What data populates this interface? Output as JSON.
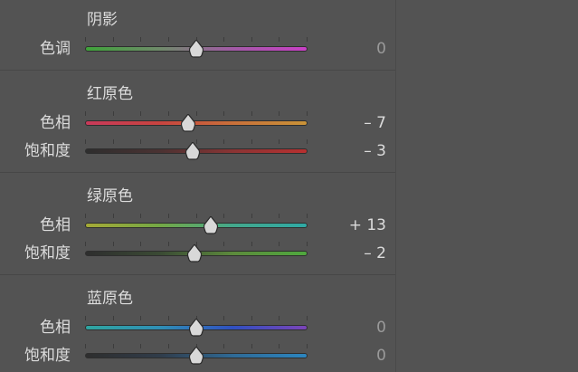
{
  "sections": [
    {
      "title": "阴影",
      "rows": [
        {
          "label": "色调",
          "value": "0",
          "level": 0.5,
          "gradient": [
            "#3fa33a",
            "#6f8a6a",
            "#a25aa6",
            "#c940c6"
          ]
        }
      ]
    },
    {
      "title": "红原色",
      "rows": [
        {
          "label": "色相",
          "value": "– 7",
          "level": 0.465,
          "gradient": [
            "#c83a5a",
            "#c74440",
            "#c9703a",
            "#c99338"
          ]
        },
        {
          "label": "饱和度",
          "value": "– 3",
          "level": 0.485,
          "gradient": [
            "#2e2e2e",
            "#4a3232",
            "#8a3434",
            "#b83030"
          ]
        }
      ]
    },
    {
      "title": "绿原色",
      "rows": [
        {
          "label": "色相",
          "value": "+ 13",
          "level": 0.565,
          "gradient": [
            "#a5a936",
            "#74a845",
            "#43a88c",
            "#2fa9a5"
          ]
        },
        {
          "label": "饱和度",
          "value": "– 2",
          "level": 0.49,
          "gradient": [
            "#2e2e2e",
            "#3a4a34",
            "#5c8a3c",
            "#4fa83e"
          ]
        }
      ]
    },
    {
      "title": "蓝原色",
      "rows": [
        {
          "label": "色相",
          "value": "0",
          "level": 0.5,
          "gradient": [
            "#2fa5a0",
            "#2f8fb5",
            "#3050c0",
            "#7b44b8"
          ]
        },
        {
          "label": "饱和度",
          "value": "0",
          "level": 0.5,
          "gradient": [
            "#2e2e2e",
            "#303c4a",
            "#2f6a96",
            "#2c86c0"
          ]
        }
      ]
    }
  ],
  "colors": {
    "panel_background": "#535353",
    "text": "#dcdcdc",
    "zero_value_text": "#9a9a9a",
    "thumb_fill": "#d8d8d8"
  }
}
